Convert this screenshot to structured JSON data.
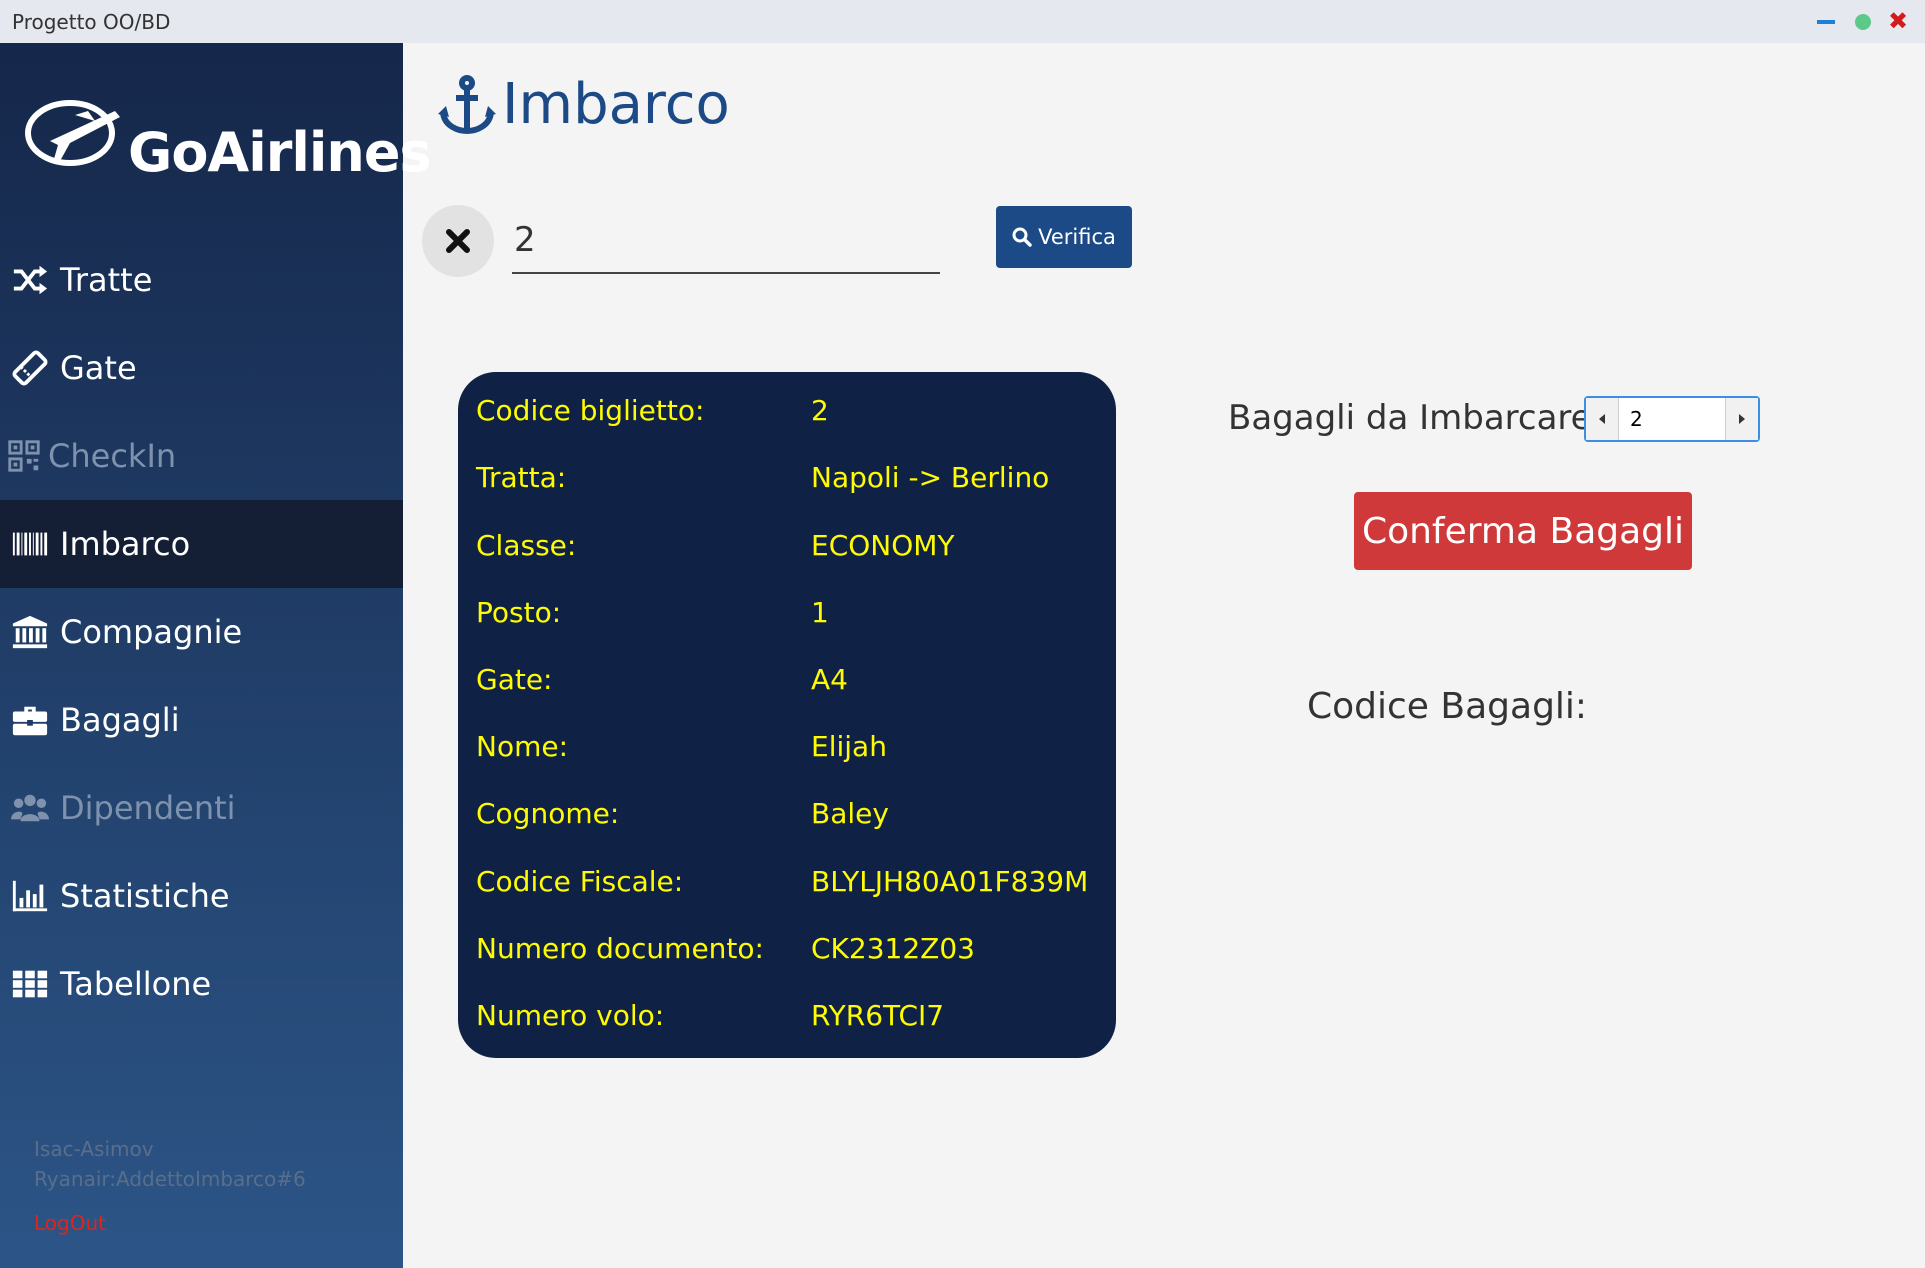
{
  "window": {
    "title": "Progetto OO/BD"
  },
  "brand": {
    "name": "GoAirlines"
  },
  "sidebar": {
    "items": [
      {
        "label": "Tratte",
        "icon": "shuffle-icon",
        "state": "normal"
      },
      {
        "label": "Gate",
        "icon": "ticket-icon",
        "state": "normal"
      },
      {
        "label": "CheckIn",
        "icon": "qrcode-icon",
        "state": "disabled"
      },
      {
        "label": "Imbarco",
        "icon": "barcode-icon",
        "state": "active"
      },
      {
        "label": "Compagnie",
        "icon": "bank-icon",
        "state": "normal"
      },
      {
        "label": "Bagagli",
        "icon": "briefcase-icon",
        "state": "normal"
      },
      {
        "label": "Dipendenti",
        "icon": "users-icon",
        "state": "disabled"
      },
      {
        "label": "Statistiche",
        "icon": "bar-chart-icon",
        "state": "normal"
      },
      {
        "label": "Tabellone",
        "icon": "grid-icon",
        "state": "normal"
      }
    ],
    "user": {
      "name": "Isac-Asimov",
      "role": "Ryanair:AddettoImbarco#6"
    },
    "logout_label": "LogOut"
  },
  "main": {
    "title": "Imbarco",
    "search": {
      "value": "2"
    },
    "verify_label": "Verifica",
    "ticket": [
      {
        "label": "Codice biglietto:",
        "value": "2"
      },
      {
        "label": "Tratta:",
        "value": "Napoli -> Berlino"
      },
      {
        "label": "Classe:",
        "value": "ECONOMY"
      },
      {
        "label": "Posto:",
        "value": "1"
      },
      {
        "label": "Gate:",
        "value": "A4"
      },
      {
        "label": "Nome:",
        "value": "Elijah"
      },
      {
        "label": "Cognome:",
        "value": "Baley"
      },
      {
        "label": "Codice Fiscale:",
        "value": "BLYLJH80A01F839M"
      },
      {
        "label": "Numero documento:",
        "value": "CK2312Z03"
      },
      {
        "label": "Numero volo:",
        "value": "RYR6TCI7"
      }
    ],
    "baggage": {
      "label": "Bagagli da Imbarcare:",
      "count": "2",
      "confirm_label": "Conferma Bagagli",
      "codes_label": "Codice Bagagli:"
    }
  },
  "colors": {
    "accent": "#1c4a86",
    "card_bg": "#0f2245",
    "card_text": "#fffb00",
    "confirm": "#d0393a",
    "logout": "#e2231a"
  }
}
